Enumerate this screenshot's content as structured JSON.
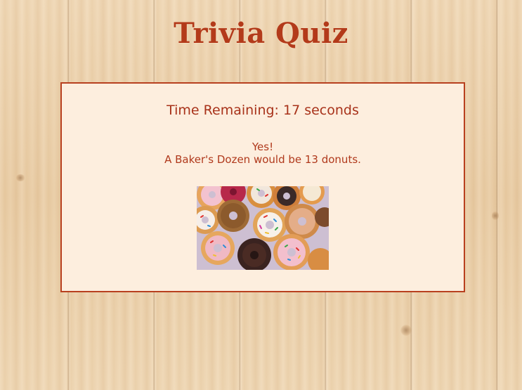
{
  "page": {
    "title": "Trivia Quiz"
  },
  "quiz": {
    "timer_text": "Time Remaining: 17 seconds",
    "result_text": "Yes!",
    "answer_text": "A Baker's Dozen would be 13 donuts.",
    "image_subject": "donuts-photo"
  },
  "colors": {
    "accent": "#b33a1a",
    "card_background": "#fdeede",
    "card_border": "#b8401f",
    "wood_background": "#ecd2ae"
  }
}
